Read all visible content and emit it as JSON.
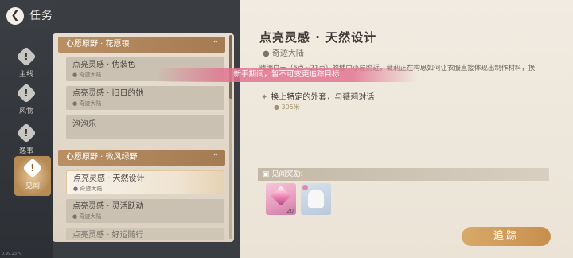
{
  "header": {
    "back_icon": "back-arrow-icon",
    "title": "任务"
  },
  "nav": [
    {
      "label": "主线",
      "icon": "exclamation-icon",
      "active": false
    },
    {
      "label": "风物",
      "icon": "exclamation-icon",
      "active": false
    },
    {
      "label": "逸事",
      "icon": "exclamation-icon",
      "active": false
    },
    {
      "label": "见闻",
      "icon": "exclamation-icon",
      "active": true
    }
  ],
  "groups": [
    {
      "title": "心愿原野 · 花愿镇",
      "items": [
        {
          "name": "点亮灵感 · 伪装色",
          "location": "奇迹大陆"
        },
        {
          "name": "点亮灵感 · 旧日的她",
          "location": "奇迹大陆"
        },
        {
          "name": "泡泡乐",
          "location": ""
        }
      ]
    },
    {
      "title": "心愿原野 · 微风绿野",
      "items": [
        {
          "name": "点亮灵感 · 天然设计",
          "location": "奇迹大陆",
          "selected": true
        },
        {
          "name": "点亮灵感 · 灵活跃动",
          "location": "奇迹大陆"
        },
        {
          "name": "点亮灵感 · 好运随行",
          "location": ""
        }
      ]
    }
  ],
  "detail": {
    "title": "点亮灵感 · 天然设计",
    "location": "奇迹大陆",
    "description": "晴朗白天（5点~21点）的埔中小屋附近，薇莉正在构思如何让衣服直接体现出制作材料，换",
    "objective": "换上特定的外套，与薇莉对话",
    "distance": "305米",
    "rewards_label": "见闻奖励:",
    "rewards": [
      {
        "icon": "crystal-icon",
        "count": "20"
      },
      {
        "icon": "outfit-icon",
        "count": ""
      }
    ],
    "track_label": "追踪"
  },
  "toast": "新手期间，暂不可变更追踪目标",
  "version": "0.99.2370"
}
